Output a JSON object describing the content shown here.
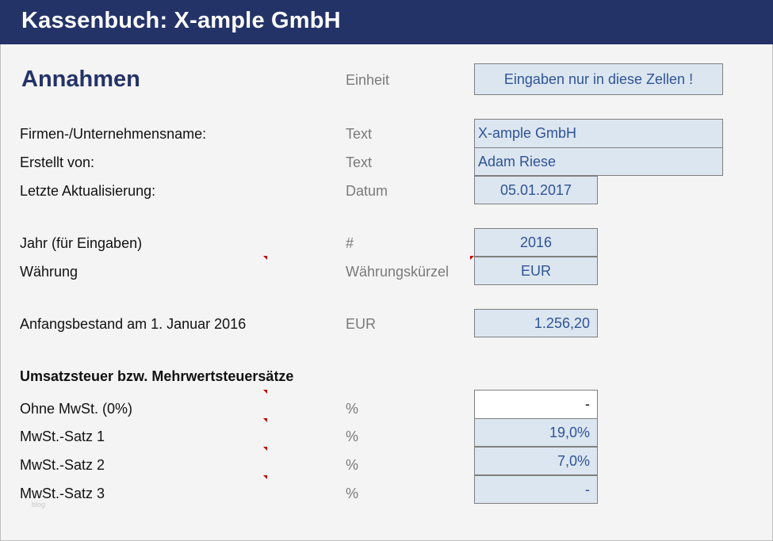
{
  "header": {
    "title": "Kassenbuch: X-ample GmbH"
  },
  "section": {
    "title": "Annahmen",
    "unit_header": "Einheit",
    "input_hint": "Eingaben nur in diese Zellen !"
  },
  "rows": {
    "company": {
      "label": "Firmen-/Unternehmensname:",
      "unit": "Text",
      "value": "X-ample GmbH"
    },
    "author": {
      "label": "Erstellt von:",
      "unit": "Text",
      "value": "Adam Riese"
    },
    "updated": {
      "label": "Letzte Aktualisierung:",
      "unit": "Datum",
      "value": "05.01.2017"
    },
    "year": {
      "label": "Jahr (für Eingaben)",
      "unit": "#",
      "value": "2016"
    },
    "currency": {
      "label": "Währung",
      "unit": "Währungskürzel",
      "value": "EUR"
    },
    "opening": {
      "label": "Anfangsbestand am 1. Januar 2016",
      "unit": "EUR",
      "value": "1.256,20"
    }
  },
  "vat": {
    "title": "Umsatzsteuer bzw. Mehrwertsteuersätze",
    "rates": [
      {
        "label": "Ohne MwSt. (0%)",
        "unit": "%",
        "value": "-"
      },
      {
        "label": "MwSt.-Satz 1",
        "unit": "%",
        "value": "19,0%"
      },
      {
        "label": "MwSt.-Satz 2",
        "unit": "%",
        "value": "7,0%"
      },
      {
        "label": "MwSt.-Satz 3",
        "unit": "%",
        "value": "-"
      }
    ]
  },
  "watermark": "blog",
  "colors": {
    "header_bg": "#243367",
    "input_bg": "#dce6f1",
    "input_text": "#2f5496",
    "comment_marker": "#c00000"
  }
}
